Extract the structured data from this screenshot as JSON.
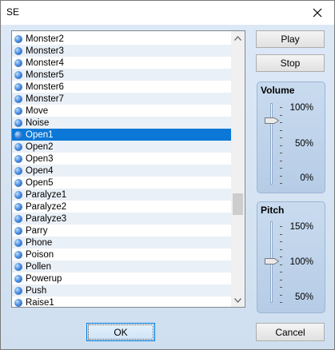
{
  "window": {
    "title": "SE"
  },
  "list": {
    "items": [
      "Monster2",
      "Monster3",
      "Monster4",
      "Monster5",
      "Monster6",
      "Monster7",
      "Move",
      "Noise",
      "Open1",
      "Open2",
      "Open3",
      "Open4",
      "Open5",
      "Paralyze1",
      "Paralyze2",
      "Paralyze3",
      "Parry",
      "Phone",
      "Poison",
      "Pollen",
      "Powerup",
      "Push",
      "Raise1"
    ],
    "selected": "Open1"
  },
  "buttons": {
    "play": "Play",
    "stop": "Stop",
    "ok": "OK",
    "cancel": "Cancel"
  },
  "volume": {
    "title": "Volume",
    "labels": [
      "100%",
      "50%",
      "0%"
    ],
    "value_percent": 100
  },
  "pitch": {
    "title": "Pitch",
    "labels": [
      "150%",
      "100%",
      "50%"
    ],
    "value_percent": 100
  },
  "colors": {
    "selection": "#0b78d7",
    "panel": "#c3d6ec",
    "primary_border": "#0078d7"
  }
}
